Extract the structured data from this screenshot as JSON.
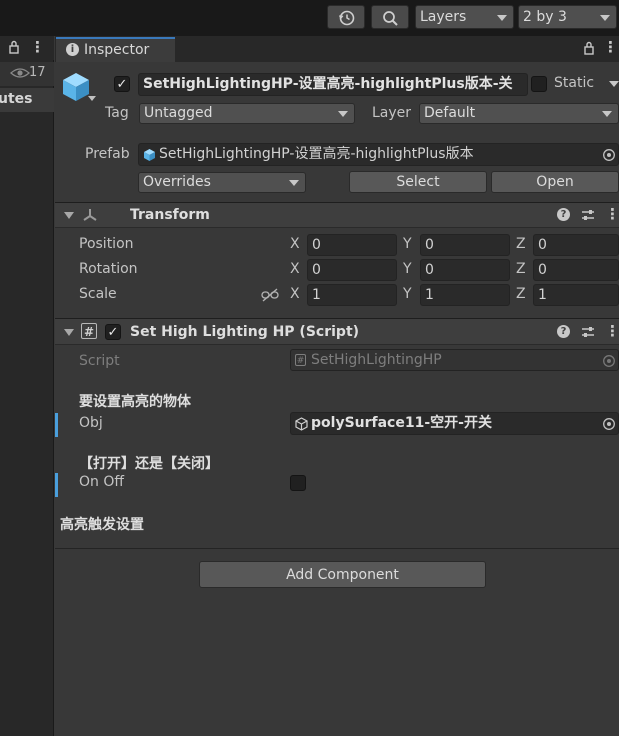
{
  "toolbar": {
    "layers_label": "Layers",
    "layout_label": "2 by 3"
  },
  "left_panel": {
    "eye_count": "17",
    "utes_text": "utes"
  },
  "inspector": {
    "tab_label": "Inspector",
    "object_name": "SetHighLightingHP-设置高亮-highlightPlus版本-关",
    "active_checked": "✓",
    "static_label": "Static",
    "tag_label": "Tag",
    "tag_value": "Untagged",
    "layer_label": "Layer",
    "layer_value": "Default",
    "prefab_label": "Prefab",
    "prefab_value": "SetHighLightingHP-设置高亮-highlightPlus版本",
    "overrides_label": "Overrides",
    "select_label": "Select",
    "open_label": "Open"
  },
  "transform": {
    "title": "Transform",
    "rows": [
      {
        "label": "Position",
        "x": "0",
        "y": "0",
        "z": "0"
      },
      {
        "label": "Rotation",
        "x": "0",
        "y": "0",
        "z": "0"
      },
      {
        "label": "Scale",
        "x": "1",
        "y": "1",
        "z": "1"
      }
    ],
    "axis_x": "X",
    "axis_y": "Y",
    "axis_z": "Z"
  },
  "script_component": {
    "title": "Set High Lighting HP (Script)",
    "enabled": "✓",
    "script_label": "Script",
    "script_value": "SetHighLightingHP",
    "header_obj": "要设置高亮的物体",
    "obj_label": "Obj",
    "obj_value": "polySurface11-空开-开关",
    "header_onoff": "【打开】还是【关闭】",
    "onoff_label": "On Off",
    "header_trigger": "高亮触发设置"
  },
  "add_component_label": "Add Component",
  "colors": {
    "accent_tab": "#3a79bb",
    "focus_bar": "#4a9fdc",
    "prefab_blue": "#5ab4e8"
  }
}
